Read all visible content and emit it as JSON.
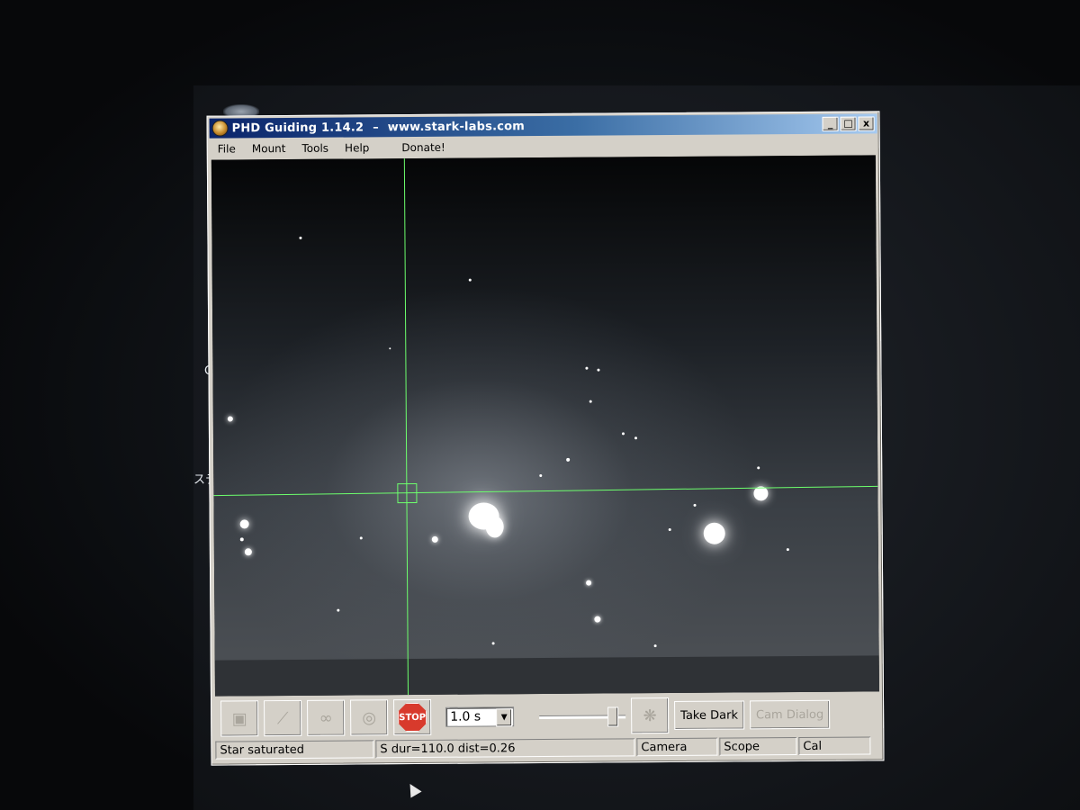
{
  "window": {
    "title": "PHD Guiding  1.14.2",
    "title_sep": "–",
    "title_url": "www.stark-labs.com",
    "buttons": {
      "minimize": "_",
      "maximize": "□",
      "close": "x"
    }
  },
  "menu": {
    "items": [
      "File",
      "Mount",
      "Tools",
      "Help",
      "Donate!"
    ]
  },
  "desktop": {
    "fragment_1": "G",
    "fragment_2": "ステ"
  },
  "toolbar": {
    "stop_label": "STOP",
    "exposure_value": "1.0 s",
    "take_dark_label": "Take Dark",
    "gamma_label": "Cam Dialog"
  },
  "status": {
    "message": "Star saturated",
    "stats": "S dur=110.0 dist=0.26",
    "camera_label": "Camera",
    "scope_label": "Scope",
    "cal_label": "Cal"
  }
}
